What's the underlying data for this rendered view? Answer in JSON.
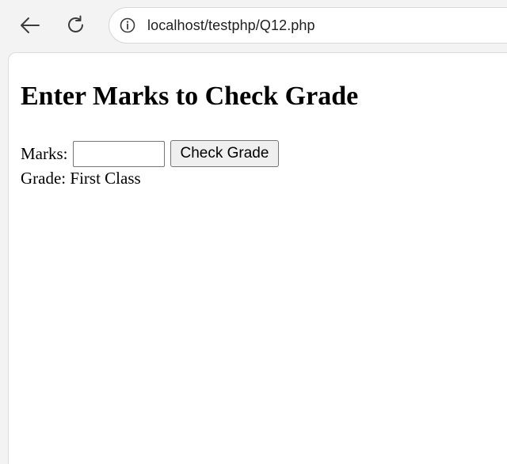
{
  "browser": {
    "url": "localhost/testphp/Q12.php",
    "icons": {
      "back": "arrow-left-icon",
      "reload": "reload-icon",
      "info": "info-icon"
    }
  },
  "page": {
    "title": "Enter Marks to Check Grade",
    "form": {
      "marks_label": "Marks:",
      "marks_value": "",
      "button_label": "Check Grade"
    },
    "grade": {
      "label": "Grade:",
      "value": "First Class"
    }
  },
  "colors": {
    "chrome_bg": "#f3f3f3",
    "page_bg": "#ffffff",
    "text": "#000000",
    "button_bg": "#efefef"
  }
}
